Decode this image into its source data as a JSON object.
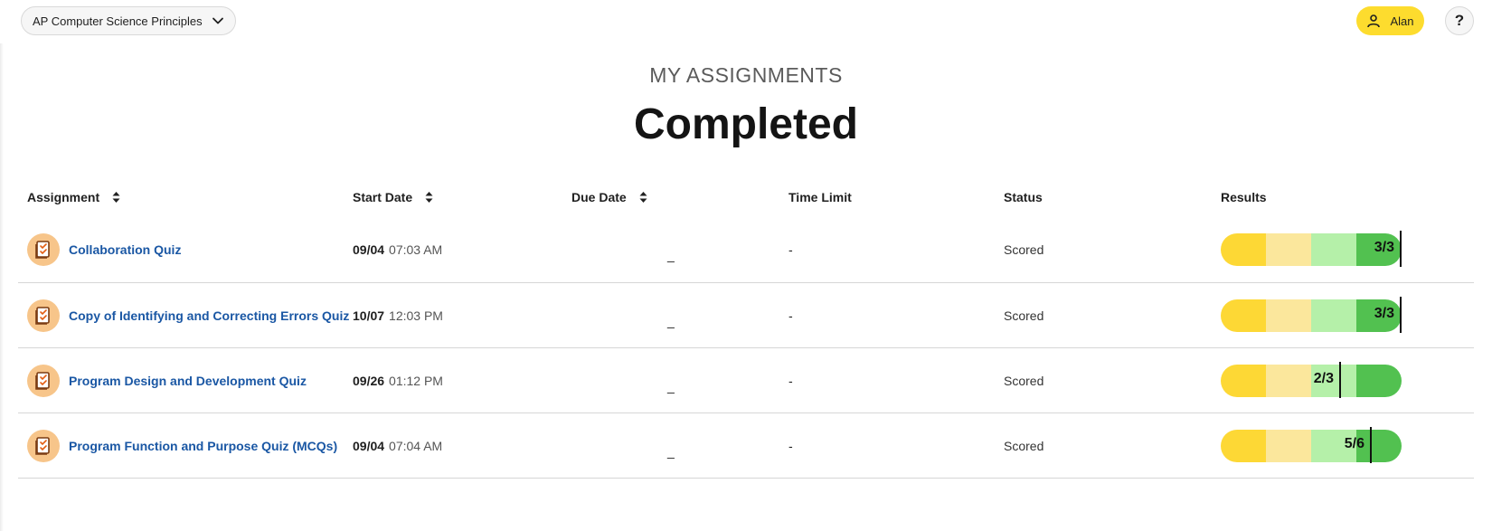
{
  "header": {
    "course": "AP Computer Science Principles",
    "user": "Alan",
    "help": "?"
  },
  "eyebrow": "MY ASSIGNMENTS",
  "title": "Completed",
  "columns": {
    "assignment": "Assignment",
    "start_date": "Start Date",
    "due_date": "Due Date",
    "time_limit": "Time Limit",
    "status": "Status",
    "results": "Results"
  },
  "rows": [
    {
      "name": "Collaboration Quiz",
      "date": "09/04",
      "time": "07:03 AM",
      "due": "_",
      "time_limit": "-",
      "status": "Scored",
      "score": "3/3",
      "fraction": 1.0
    },
    {
      "name": "Copy of Identifying and Correcting Errors Quiz",
      "date": "10/07",
      "time": "12:03 PM",
      "due": "_",
      "time_limit": "-",
      "status": "Scored",
      "score": "3/3",
      "fraction": 1.0
    },
    {
      "name": "Program Design and Development Quiz",
      "date": "09/26",
      "time": "01:12 PM",
      "due": "_",
      "time_limit": "-",
      "status": "Scored",
      "score": "2/3",
      "fraction": 0.667
    },
    {
      "name": "Program Function and Purpose Quiz (MCQs)",
      "date": "09/04",
      "time": "07:04 AM",
      "due": "_",
      "time_limit": "-",
      "status": "Scored",
      "score": "5/6",
      "fraction": 0.833
    }
  ],
  "colors": {
    "accent_yellow": "#fddc2e",
    "link_blue": "#1a57a4",
    "bar_yellow": "#fdd835",
    "bar_light_yellow": "#fbe79c",
    "bar_light_green": "#b5f0a9",
    "bar_green": "#52c150"
  }
}
